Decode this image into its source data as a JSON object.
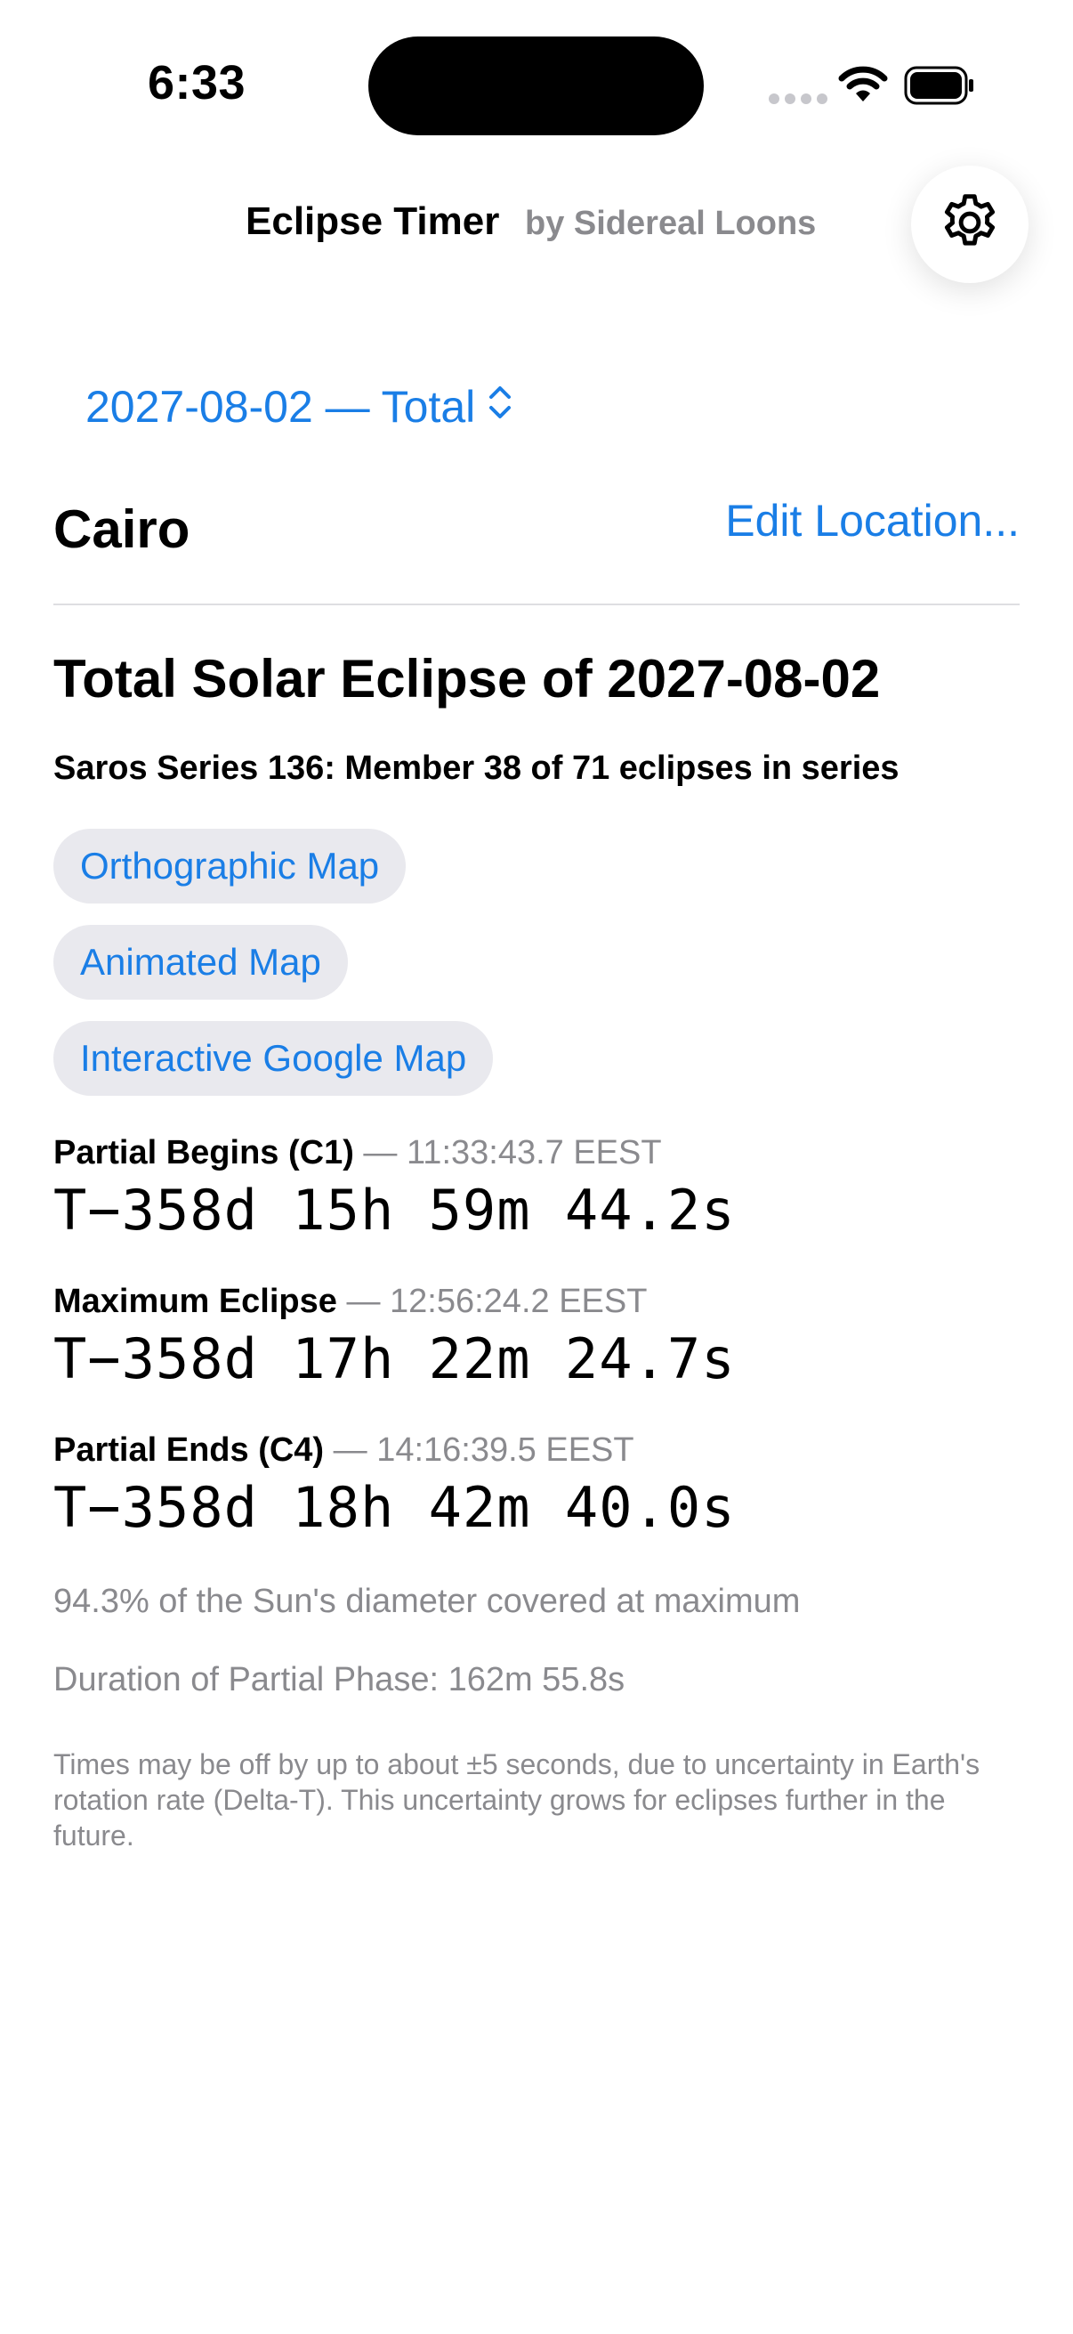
{
  "status_bar": {
    "time": "6:33",
    "icons": [
      "cellular-signal-icon",
      "wifi-icon",
      "battery-icon"
    ]
  },
  "header": {
    "title": "Eclipse Timer",
    "subtitle": "by Sidereal Loons",
    "settings_icon": "gear-icon"
  },
  "eclipse_picker": {
    "label": "2027-08-02 — Total",
    "icon": "chevron-up-down-icon"
  },
  "location": {
    "city": "Cairo",
    "edit_label": "Edit Location..."
  },
  "eclipse": {
    "title": "Total Solar Eclipse of 2027-08-02",
    "saros": "Saros Series 136: Member 38 of 71 eclipses in series",
    "map_links": [
      {
        "label": "Orthographic Map"
      },
      {
        "label": "Animated Map"
      },
      {
        "label": "Interactive Google Map"
      }
    ],
    "events": [
      {
        "name": "Partial Begins (C1)",
        "time": " — 11:33:43.7 EEST",
        "countdown": "T−358d 15h 59m 44.2s"
      },
      {
        "name": "Maximum Eclipse",
        "time": " — 12:56:24.2 EEST",
        "countdown": "T−358d 17h 22m 24.7s"
      },
      {
        "name": "Partial Ends (C4)",
        "time": " — 14:16:39.5 EEST",
        "countdown": "T−358d 18h 42m 40.0s"
      }
    ],
    "coverage": "94.3% of the Sun's diameter covered at maximum",
    "duration": "Duration of Partial Phase: 162m 55.8s",
    "disclaimer": "Times may be off by up to about ±5 seconds, due to uncertainty in Earth's rotation rate (Delta-T). This uncertainty grows for eclipses further in the future."
  },
  "colors": {
    "accent": "#1a7ee6",
    "secondary_text": "#8a8a8e",
    "pill_background": "#e9e9ee"
  }
}
